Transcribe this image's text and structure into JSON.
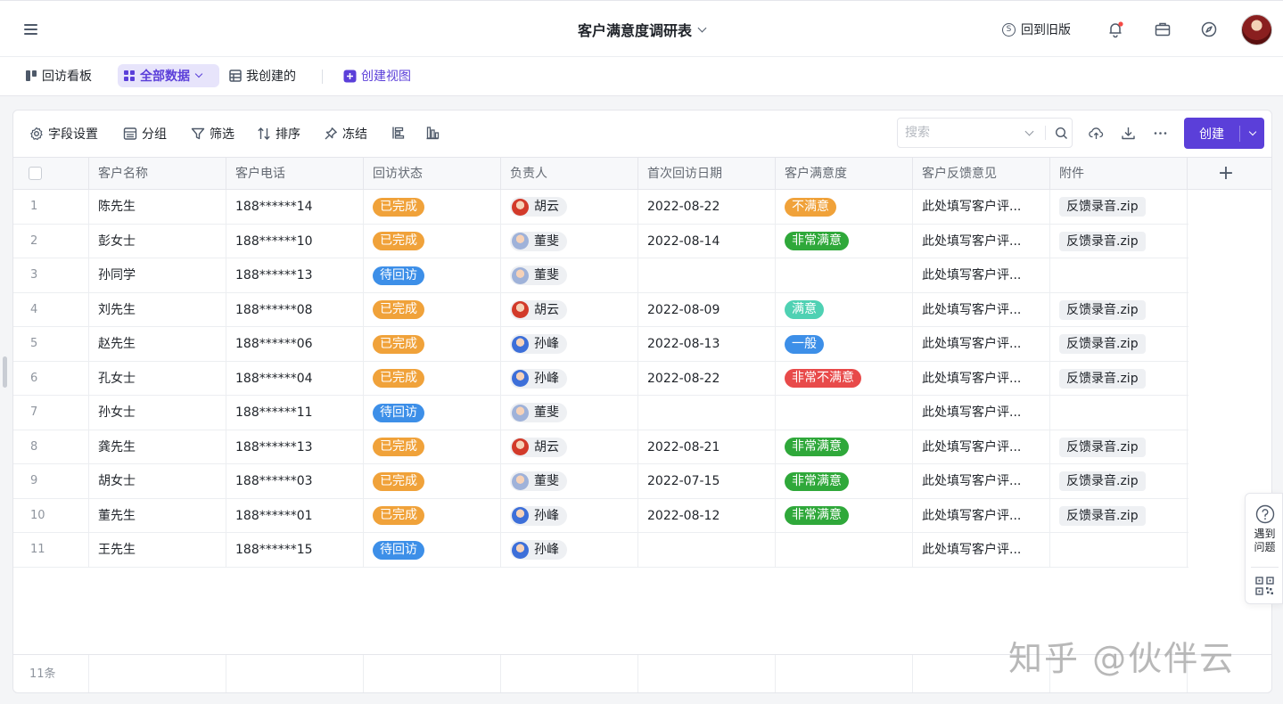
{
  "app": {
    "title": "客户满意度调研表",
    "old_version": "回到旧版"
  },
  "views": [
    {
      "label": "回访看板"
    },
    {
      "label": "全部数据"
    },
    {
      "label": "我创建的"
    },
    {
      "label": "创建视图"
    }
  ],
  "toolbar": {
    "field_settings": "字段设置",
    "group": "分组",
    "filter": "筛选",
    "sort": "排序",
    "freeze": "冻结",
    "search_placeholder": "搜索",
    "create": "创建"
  },
  "columns": [
    "客户名称",
    "客户电话",
    "回访状态",
    "负责人",
    "首次回访日期",
    "客户满意度",
    "客户反馈意见",
    "附件"
  ],
  "colors": {
    "accent": "#5b3fd9",
    "status_done": "#f0a23a",
    "status_pending": "#3d8fe8",
    "sat_unsatisfied": "#f0a23a",
    "sat_very_satisfied": "#2fa83a",
    "sat_satisfied": "#4fd1b3",
    "sat_normal": "#3d8fe8",
    "sat_very_unsatisfied": "#e84a4a"
  },
  "rows": [
    {
      "idx": "1",
      "name": "陈先生",
      "phone": "188******14",
      "status": "已完成",
      "owner": "胡云",
      "date": "2022-08-22",
      "sat": "不满意",
      "feedback": "此处填写客户评...",
      "file": "反馈录音.zip"
    },
    {
      "idx": "2",
      "name": "彭女士",
      "phone": "188******10",
      "status": "已完成",
      "owner": "董斐",
      "date": "2022-08-14",
      "sat": "非常满意",
      "feedback": "此处填写客户评...",
      "file": "反馈录音.zip"
    },
    {
      "idx": "3",
      "name": "孙同学",
      "phone": "188******13",
      "status": "待回访",
      "owner": "董斐",
      "date": "",
      "sat": "",
      "feedback": "此处填写客户评...",
      "file": ""
    },
    {
      "idx": "4",
      "name": "刘先生",
      "phone": "188******08",
      "status": "已完成",
      "owner": "胡云",
      "date": "2022-08-09",
      "sat": "满意",
      "feedback": "此处填写客户评...",
      "file": "反馈录音.zip"
    },
    {
      "idx": "5",
      "name": "赵先生",
      "phone": "188******06",
      "status": "已完成",
      "owner": "孙峰",
      "date": "2022-08-13",
      "sat": "一般",
      "feedback": "此处填写客户评...",
      "file": "反馈录音.zip"
    },
    {
      "idx": "6",
      "name": "孔女士",
      "phone": "188******04",
      "status": "已完成",
      "owner": "孙峰",
      "date": "2022-08-22",
      "sat": "非常不满意",
      "feedback": "此处填写客户评...",
      "file": "反馈录音.zip"
    },
    {
      "idx": "7",
      "name": "孙女士",
      "phone": "188******11",
      "status": "待回访",
      "owner": "董斐",
      "date": "",
      "sat": "",
      "feedback": "此处填写客户评...",
      "file": ""
    },
    {
      "idx": "8",
      "name": "龚先生",
      "phone": "188******13",
      "status": "已完成",
      "owner": "胡云",
      "date": "2022-08-21",
      "sat": "非常满意",
      "feedback": "此处填写客户评...",
      "file": "反馈录音.zip"
    },
    {
      "idx": "9",
      "name": "胡女士",
      "phone": "188******03",
      "status": "已完成",
      "owner": "董斐",
      "date": "2022-07-15",
      "sat": "非常满意",
      "feedback": "此处填写客户评...",
      "file": "反馈录音.zip"
    },
    {
      "idx": "10",
      "name": "董先生",
      "phone": "188******01",
      "status": "已完成",
      "owner": "孙峰",
      "date": "2022-08-12",
      "sat": "非常满意",
      "feedback": "此处填写客户评...",
      "file": "反馈录音.zip"
    },
    {
      "idx": "11",
      "name": "王先生",
      "phone": "188******15",
      "status": "待回访",
      "owner": "孙峰",
      "date": "",
      "sat": "",
      "feedback": "此处填写客户评...",
      "file": ""
    }
  ],
  "footer": {
    "count": "11条"
  },
  "help": {
    "line1": "遇到",
    "line2": "问题"
  },
  "watermark": "知乎 @伙伴云"
}
